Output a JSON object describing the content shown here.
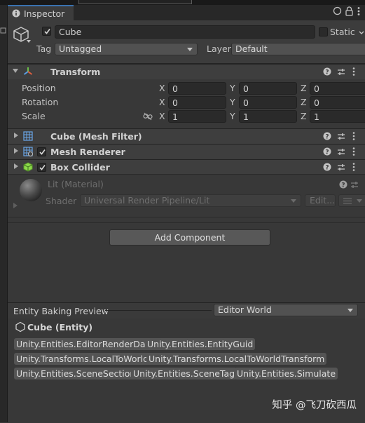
{
  "window": {
    "tab_label": "Inspector"
  },
  "object": {
    "name": "Cube",
    "active": true,
    "static_label": "Static",
    "tag_label": "Tag",
    "tag_value": "Untagged",
    "layer_label": "Layer",
    "layer_value": "Default"
  },
  "transform": {
    "title": "Transform",
    "rows": [
      {
        "label": "Position",
        "x": "0",
        "y": "0",
        "z": "0"
      },
      {
        "label": "Rotation",
        "x": "0",
        "y": "0",
        "z": "0"
      },
      {
        "label": "Scale",
        "x": "1",
        "y": "1",
        "z": "1"
      }
    ],
    "axes": {
      "x": "X",
      "y": "Y",
      "z": "Z"
    }
  },
  "components": [
    {
      "title": "Cube (Mesh Filter)",
      "enabled": null
    },
    {
      "title": "Mesh Renderer",
      "enabled": true
    },
    {
      "title": "Box Collider",
      "enabled": true
    }
  ],
  "material": {
    "title": "Lit (Material)",
    "shader_label": "Shader",
    "shader_value": "Universal Render Pipeline/Lit",
    "edit_label": "Edit..."
  },
  "add_component_label": "Add Component",
  "entity_baking": {
    "title": "Entity Baking Preview",
    "world_value": "Editor World",
    "entity_name": "Cube (Entity)",
    "components": [
      "Unity.Entities.EditorRenderData",
      "Unity.Entities.EntityGuid",
      "Unity.Transforms.LocalToWorld",
      "Unity.Transforms.LocalToWorldTransform",
      "Unity.Entities.SceneSection",
      "Unity.Entities.SceneTag",
      "Unity.Entities.Simulate"
    ]
  },
  "watermark": "知乎 @飞刀砍西瓜",
  "colors": {
    "accent": "#3a72b0",
    "panel": "#383838",
    "header": "#3c3c3c",
    "chip": "#545454"
  }
}
